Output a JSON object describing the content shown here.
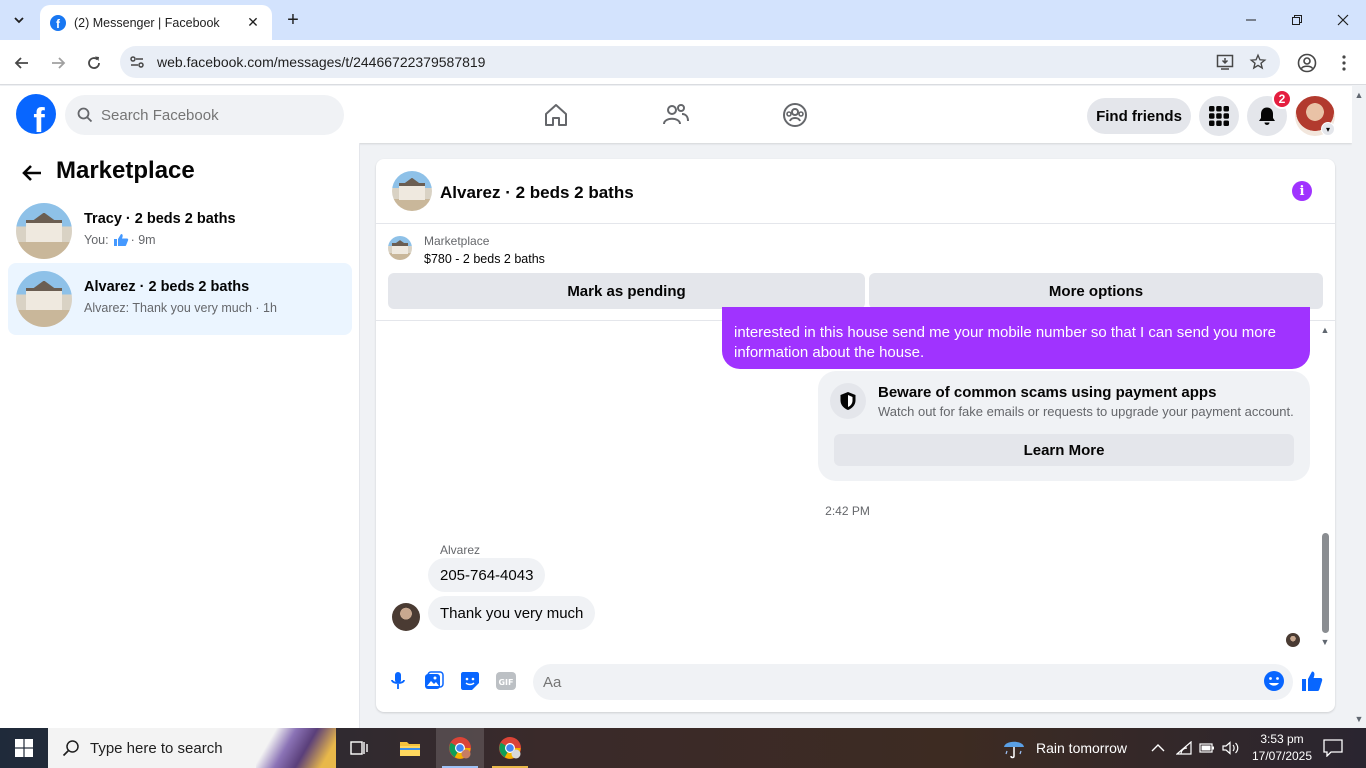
{
  "browser": {
    "tab_title": "(2) Messenger | Facebook",
    "url": "web.facebook.com/messages/t/24466722379587819"
  },
  "header": {
    "search_placeholder": "Search Facebook",
    "find_friends": "Find friends",
    "notification_count": "2"
  },
  "sidebar": {
    "title": "Marketplace",
    "conversations": [
      {
        "name": "Tracy · 2 beds 2 baths",
        "preview_prefix": "You:",
        "preview_suffix": "· 9m"
      },
      {
        "name": "Alvarez · 2 beds 2 baths",
        "preview": "Alvarez: Thank you very much · 1h"
      }
    ]
  },
  "chat": {
    "title": "Alvarez · 2 beds 2 baths",
    "listing": {
      "source": "Marketplace",
      "price": "$780 - 2 beds 2 baths",
      "mark_pending": "Mark as pending",
      "more_options": "More options"
    },
    "outgoing_text": "interested in this house send me your mobile number so that I can send you more information about the house.",
    "scam_card": {
      "heading": "Beware of common scams using payment apps",
      "description": "Watch out for fake emails or requests to upgrade your payment account.",
      "button": "Learn More"
    },
    "timestamp": "2:42 PM",
    "sender": "Alvarez",
    "incoming": [
      "205-764-4043",
      "Thank you very much"
    ],
    "composer_placeholder": "Aa"
  },
  "taskbar": {
    "search_text": "Type here to search",
    "weather": "Rain tomorrow",
    "time": "3:53 pm",
    "date": "17/07/2025"
  },
  "colors": {
    "fb_blue": "#0866ff",
    "messenger_purple": "#a033ff",
    "active_row": "#ebf5ff"
  }
}
